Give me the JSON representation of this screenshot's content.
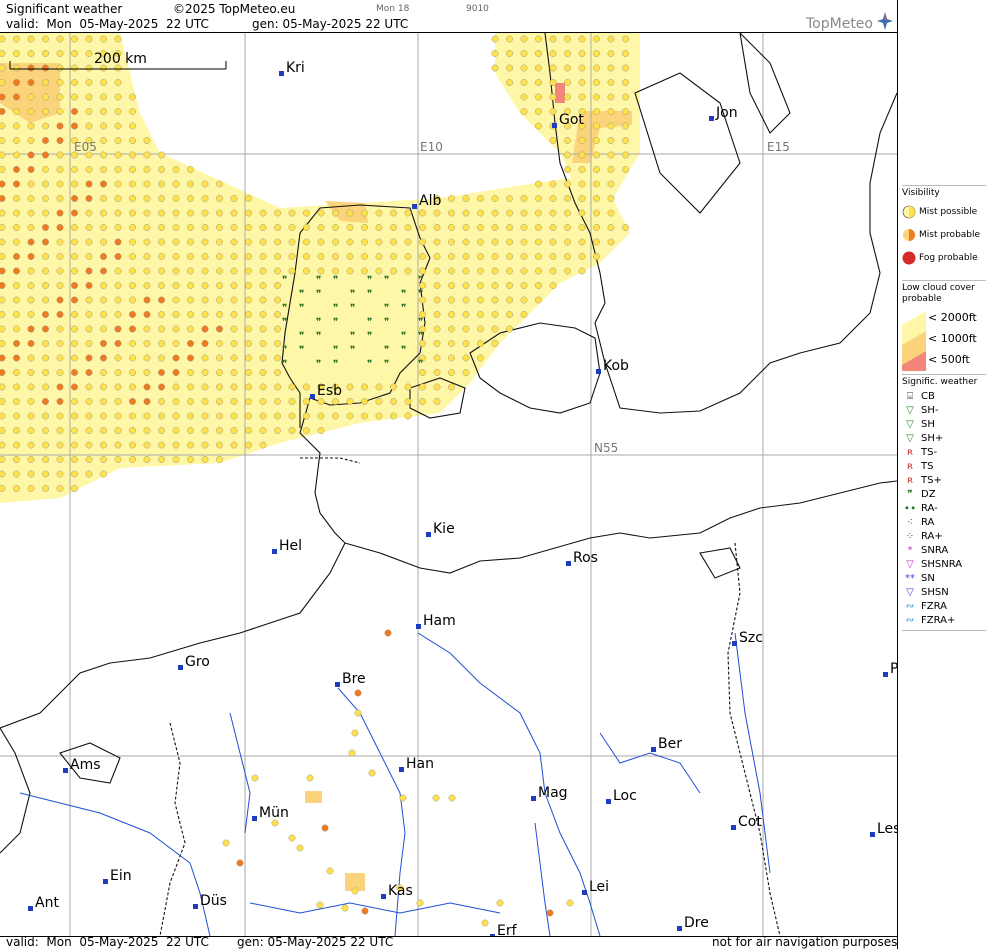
{
  "header": {
    "title": "Significant weather",
    "copyright": "©2025 TopMeteo.eu",
    "valid": "valid:  Mon  05-May-2025  22 UTC",
    "gen": "gen: 05-May-2025 22 UTC",
    "day_tag": "Mon 18",
    "code": "9010"
  },
  "logo": "TopMeteo",
  "scale_label": "200 km",
  "grid_labels": [
    "E05",
    "E10",
    "E15",
    "N55"
  ],
  "cities": [
    {
      "name": "Kri"
    },
    {
      "name": "Got"
    },
    {
      "name": "Jon"
    },
    {
      "name": "Alb"
    },
    {
      "name": "Kob"
    },
    {
      "name": "Esb"
    },
    {
      "name": "Kie"
    },
    {
      "name": "Hel"
    },
    {
      "name": "Ros"
    },
    {
      "name": "Ham"
    },
    {
      "name": "Szc"
    },
    {
      "name": "Gro"
    },
    {
      "name": "Bre"
    },
    {
      "name": "P"
    },
    {
      "name": "Ams"
    },
    {
      "name": "Han"
    },
    {
      "name": "Ber"
    },
    {
      "name": "Mag"
    },
    {
      "name": "Loc"
    },
    {
      "name": "Mün"
    },
    {
      "name": "Cot"
    },
    {
      "name": "Les"
    },
    {
      "name": "Ein"
    },
    {
      "name": "Kas"
    },
    {
      "name": "Lei"
    },
    {
      "name": "Ant"
    },
    {
      "name": "Düs"
    },
    {
      "name": "Dre"
    },
    {
      "name": "Erf"
    }
  ],
  "legend": {
    "visibility_title": "Visibility",
    "visibility_items": [
      "Mist possible",
      "Mist probable",
      "Fog probable"
    ],
    "cloud_title": "Low cloud cover probable",
    "cloud_items": [
      "< 2000ft",
      "< 1000ft",
      "<   500ft"
    ],
    "sigwx_title": "Signific. weather",
    "sigwx_items": [
      "CB",
      "SH-",
      "SH",
      "SH+",
      "TS-",
      "TS",
      "TS+",
      "DZ",
      "RA-",
      "RA",
      "RA+",
      "SNRA",
      "SHSNRA",
      "SN",
      "SHSN",
      "FZRA",
      "FZRA+"
    ]
  },
  "footer": {
    "valid": "valid:  Mon  05-May-2025  22 UTC",
    "gen": "gen: 05-May-2025 22 UTC",
    "disclaimer": "not for air navigation purposes"
  },
  "colors": {
    "cloud_2000": "#fff7a8",
    "cloud_1000": "#fbd37a",
    "cloud_500": "#f4857a",
    "mist_possible": "#ffe24a",
    "mist_probable": "#f07a1e",
    "fog": "#d42a2a",
    "city_dot": "#1f3bbf",
    "river": "#1f4fd0",
    "drizzle": "#1f6b1f"
  }
}
